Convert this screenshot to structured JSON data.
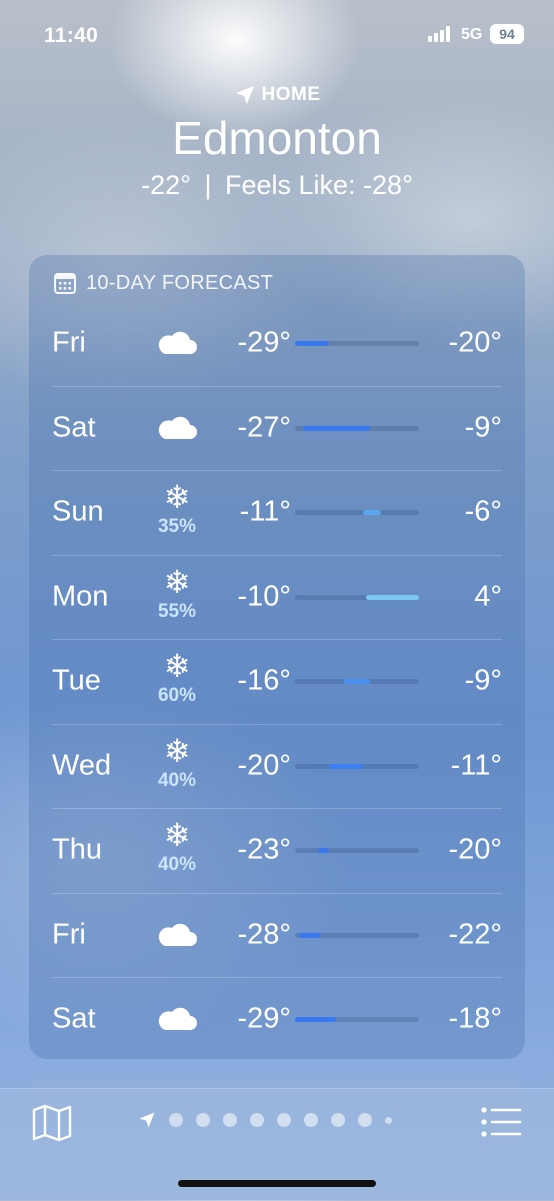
{
  "status": {
    "time": "11:40",
    "network": "5G",
    "battery": "94"
  },
  "header": {
    "label": "HOME",
    "city": "Edmonton",
    "current": "-22°",
    "divider": "|",
    "feels_like": "Feels Like: -28°"
  },
  "forecast": {
    "title": "10-DAY FORECAST",
    "scale": {
      "min": -29,
      "max": 4
    },
    "days": [
      {
        "day": "Fri",
        "icon": "cloud-icon",
        "precip": "",
        "low": "-29°",
        "high": "-20°",
        "low_val": -29,
        "high_val": -20,
        "color": "#3a78f0"
      },
      {
        "day": "Sat",
        "icon": "cloud-icon",
        "precip": "",
        "low": "-27°",
        "high": "-9°",
        "low_val": -27,
        "high_val": -9,
        "color": "#3a78f0"
      },
      {
        "day": "Sun",
        "icon": "snowflake-icon",
        "precip": "35%",
        "low": "-11°",
        "high": "-6°",
        "low_val": -11,
        "high_val": -6,
        "color": "#5aa8f0"
      },
      {
        "day": "Mon",
        "icon": "snowflake-icon",
        "precip": "55%",
        "low": "-10°",
        "high": "4°",
        "low_val": -10,
        "high_val": 4,
        "color": "#7cc8f5"
      },
      {
        "day": "Tue",
        "icon": "snowflake-icon",
        "precip": "60%",
        "low": "-16°",
        "high": "-9°",
        "low_val": -16,
        "high_val": -9,
        "color": "#4a90f0"
      },
      {
        "day": "Wed",
        "icon": "snowflake-icon",
        "precip": "40%",
        "low": "-20°",
        "high": "-11°",
        "low_val": -20,
        "high_val": -11,
        "color": "#3a80f0"
      },
      {
        "day": "Thu",
        "icon": "snowflake-icon",
        "precip": "40%",
        "low": "-23°",
        "high": "-20°",
        "low_val": -23,
        "high_val": -20,
        "color": "#3a78f0"
      },
      {
        "day": "Fri",
        "icon": "cloud-icon",
        "precip": "",
        "low": "-28°",
        "high": "-22°",
        "low_val": -28,
        "high_val": -22,
        "color": "#3a78f0"
      },
      {
        "day": "Sat",
        "icon": "cloud-icon",
        "precip": "",
        "low": "-29°",
        "high": "-18°",
        "low_val": -29,
        "high_val": -18,
        "color": "#3a78f0"
      }
    ]
  },
  "tabbar": {
    "pages": 9
  }
}
